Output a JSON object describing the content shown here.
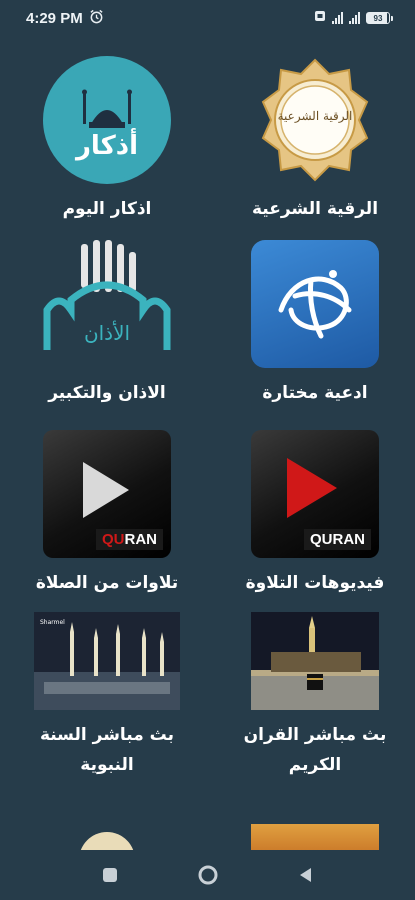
{
  "status_bar": {
    "time": "4:29 PM",
    "battery": "93"
  },
  "tiles": [
    {
      "label": "الرقية الشرعية",
      "icon": "ruqya-icon",
      "art_text": "الرقية الشرعية"
    },
    {
      "label": "اذكار اليوم",
      "icon": "azkar-icon",
      "art_text": "أذكار"
    },
    {
      "label": "ادعية مختارة",
      "icon": "dua-icon"
    },
    {
      "label": "الاذان والتكبير",
      "icon": "adhan-icon",
      "art_text": "الأذان"
    },
    {
      "label": "فيديوهات التلاوة",
      "icon": "video-play-icon",
      "art_text": "QURAN"
    },
    {
      "label": "تلاوات من الصلاة",
      "icon": "video-play-icon",
      "art_text": "QURAN"
    },
    {
      "label": "بث مباشر القران الكريم",
      "icon": "kaaba-photo"
    },
    {
      "label": "بث مباشر السنة النبوية",
      "icon": "prophet-mosque-photo"
    }
  ],
  "colors": {
    "background": "#263c4a",
    "azkar_teal": "#3aa7b6",
    "dua_blue": "#2f72c0",
    "adhan_teal": "#3bb3be",
    "play_red": "#d01818"
  },
  "nav": {
    "recents": "square-icon",
    "home": "circle-icon",
    "back": "triangle-back-icon"
  }
}
